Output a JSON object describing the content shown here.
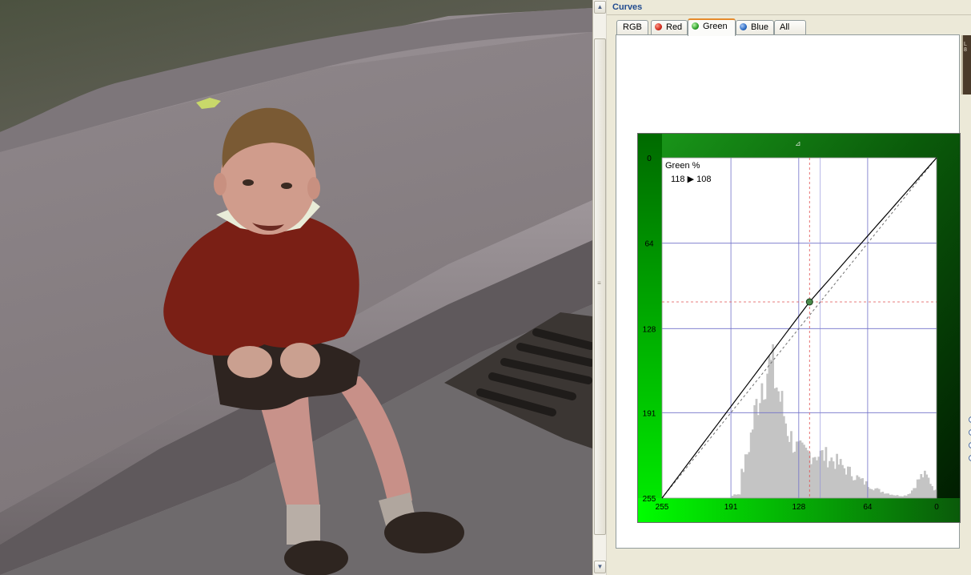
{
  "panel": {
    "title": "Curves",
    "tabs": [
      {
        "label": "RGB",
        "dot": null
      },
      {
        "label": "Red",
        "dot": "#d12a1c"
      },
      {
        "label": "Green",
        "dot": "#2fa12b",
        "active": true
      },
      {
        "label": "Blue",
        "dot": "#2c6bc4"
      },
      {
        "label": "All",
        "dot": null
      }
    ]
  },
  "curve": {
    "channel": "Green %",
    "readout": "118 ▶ 108",
    "y_ticks": [
      "0",
      "64",
      "128",
      "191",
      "255"
    ],
    "x_ticks": [
      "255",
      "191",
      "128",
      "64",
      "0"
    ],
    "control_point": {
      "input": 118,
      "output": 108
    },
    "colors": {
      "grid": "#7070c8",
      "guide": "#e05050",
      "histogram": "#c4c4c4",
      "curve": "#000000",
      "green_bright": "#00ff00",
      "green_dark": "#003000"
    }
  },
  "right_strip_text": "L 8"
}
